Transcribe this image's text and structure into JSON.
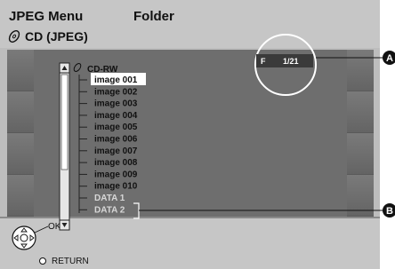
{
  "header": {
    "title": "JPEG Menu",
    "folder_label": "Folder",
    "disc_label": "CD (JPEG)"
  },
  "tree": {
    "root": "CD-RW",
    "items": [
      "image 001",
      "image 002",
      "image 003",
      "image 004",
      "image 005",
      "image 006",
      "image 007",
      "image 008",
      "image 009",
      "image 010"
    ],
    "selected_index": 0,
    "data_items": [
      "DATA 1",
      "DATA 2"
    ]
  },
  "counter": {
    "folder_prefix": "F",
    "value": "1/21"
  },
  "callouts": {
    "a": "A",
    "b": "B"
  },
  "footer": {
    "ok_label": "OK",
    "return_label": "RETURN"
  },
  "colors": {
    "background": "#bdbdbd",
    "main_panel": "#6e6e6e",
    "selected_highlight": "#ffffff",
    "data_folder_text": "#d8d8d8"
  }
}
